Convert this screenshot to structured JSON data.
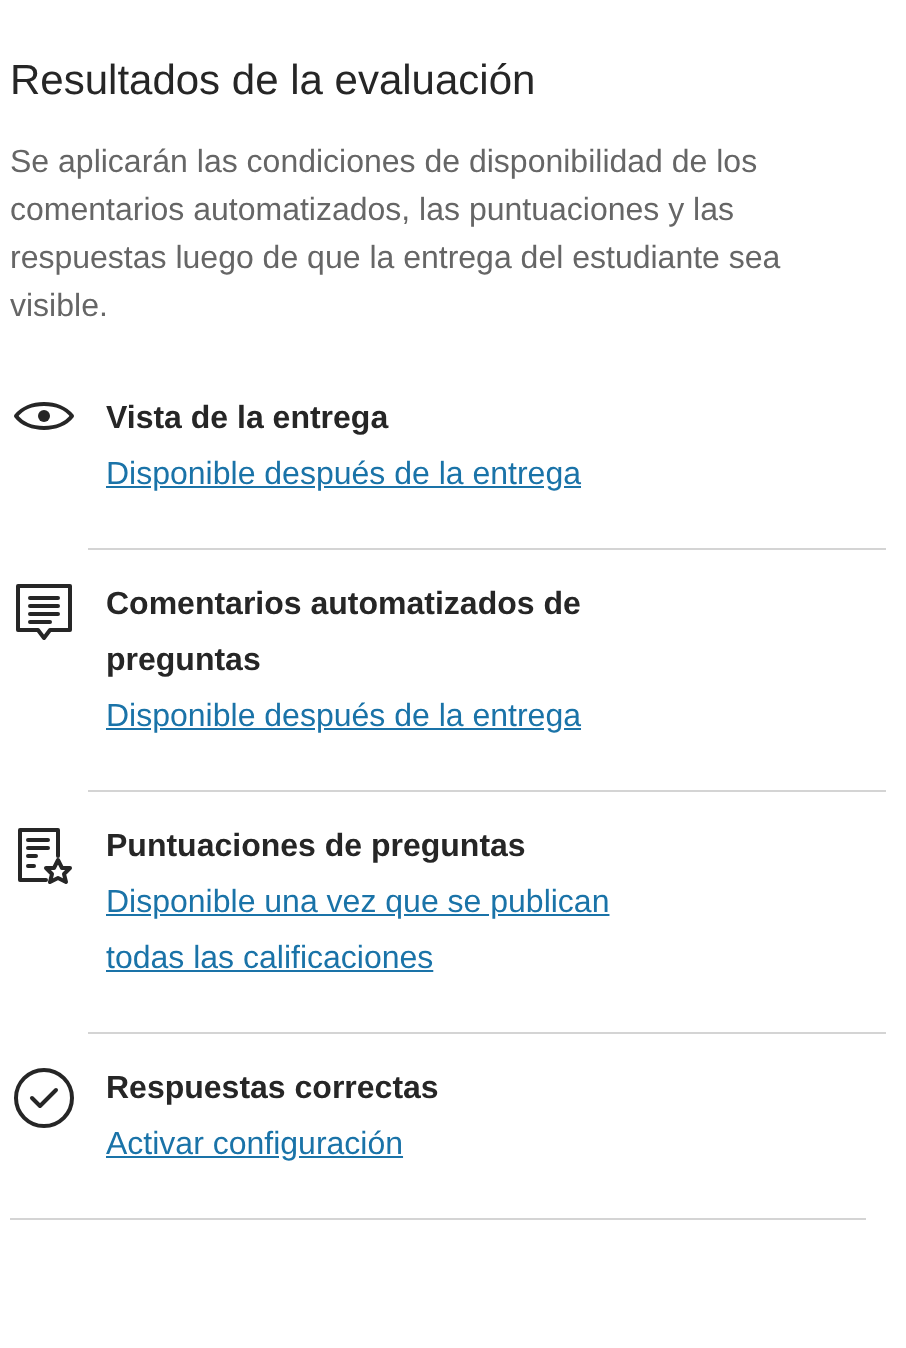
{
  "title": "Resultados de la evaluación",
  "description": "Se aplicarán las condiciones de disponibilidad de los comentarios automatizados, las puntuaciones y las respuestas luego de que la entrega del estudiante sea visible.",
  "items": [
    {
      "kind": "eye",
      "label": "Vista de la entrega",
      "link": "Disponible después de la entrega"
    },
    {
      "kind": "comment",
      "label": "Comentarios automatizados de preguntas",
      "link": "Disponible después de la entrega"
    },
    {
      "kind": "score",
      "label": "Puntuaciones de preguntas",
      "link": "Disponible una vez que se publican todas las calificaciones"
    },
    {
      "kind": "check",
      "label": "Respuestas correctas",
      "link": "Activar configuración"
    }
  ]
}
